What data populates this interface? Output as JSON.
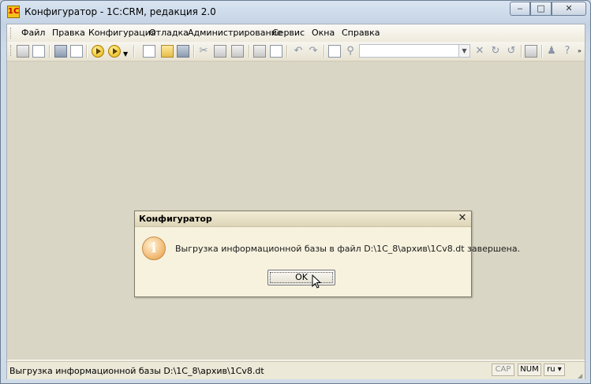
{
  "window": {
    "title": "Конфигуратор - 1С:CRM, редакция 2.0",
    "app_icon_glyph": "1С",
    "controls": {
      "minimize": "‒",
      "maximize": "□",
      "close": "✕"
    }
  },
  "menu": {
    "items": [
      "Файл",
      "Правка",
      "Конфигурация",
      "Отладка",
      "Администрирование",
      "Сервис",
      "Окна",
      "Справка"
    ]
  },
  "toolbar": {
    "search_value": "",
    "icons": [
      "config-tree-icon",
      "config-window-icon",
      "database-icon",
      "module-icon",
      "run-debug-icon",
      "run-debug-dropdown-icon",
      "new-icon",
      "open-icon",
      "save-icon",
      "cut-icon",
      "copy-icon",
      "paste-icon",
      "print-icon",
      "print-preview-icon",
      "undo-icon",
      "redo-icon",
      "find-icon",
      "find-next-icon",
      "search-dropdown-icon",
      "clear-search-icon",
      "search-back-icon",
      "search-forward-icon",
      "windows-icon",
      "help-wizard-icon",
      "help-icon"
    ]
  },
  "dialog": {
    "title": "Конфигуратор",
    "message": "Выгрузка информационной базы в файл D:\\1C_8\\архив\\1Cv8.dt завершена.",
    "ok_label": "OK",
    "info_glyph": "i",
    "close_glyph": "✕"
  },
  "statusbar": {
    "text": "Выгрузка информационной базы D:\\1C_8\\архив\\1Cv8.dt",
    "cap": "CAP",
    "num": "NUM",
    "lang": "ru ▾"
  },
  "colors": {
    "workspace": "#dad6c5",
    "dialog_bg": "#f7f2de",
    "info_icon": "#f0b56b",
    "titlebar": "#c4d3e4"
  }
}
